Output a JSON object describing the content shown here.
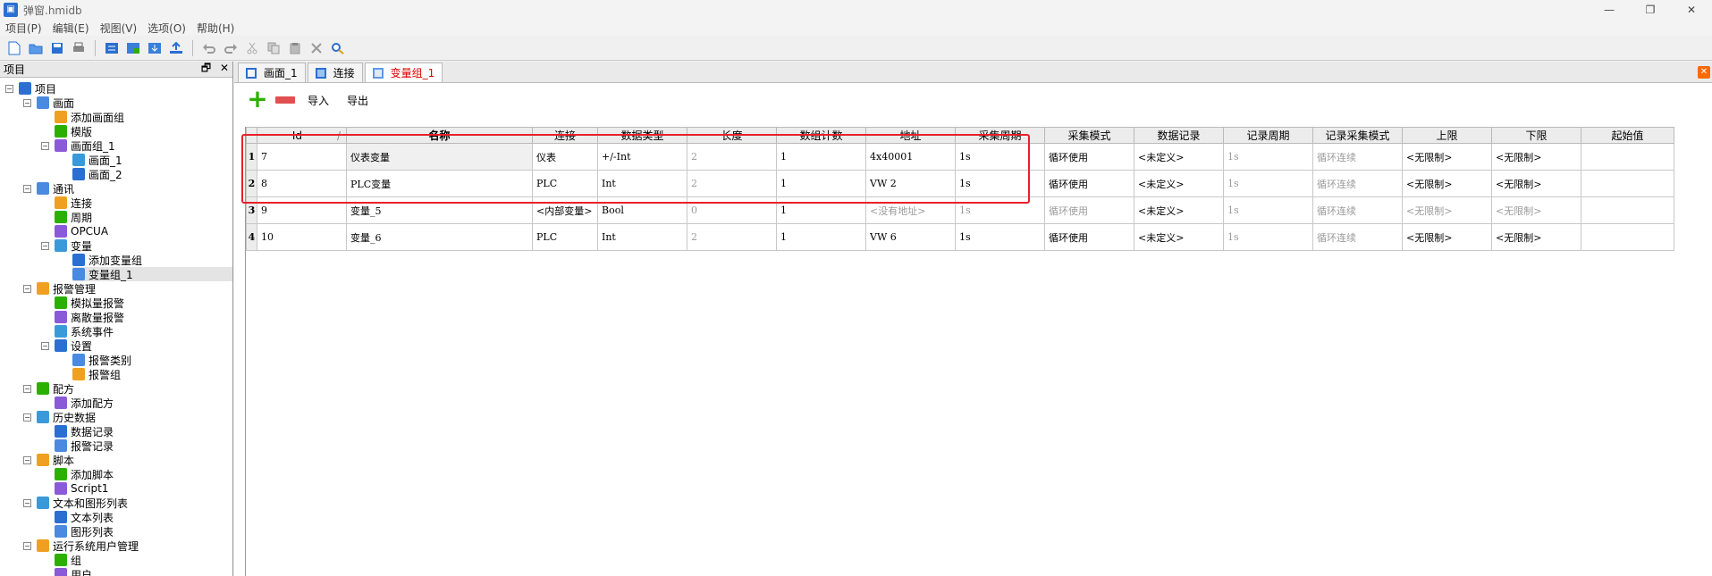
{
  "window": {
    "title": "弹窗.hmidb",
    "minimize": "—",
    "restore": "❐",
    "close": "✕"
  },
  "menu": [
    "项目(P)",
    "编辑(E)",
    "视图(V)",
    "选项(O)",
    "帮助(H)"
  ],
  "tree": {
    "header": "项目",
    "pin": "🗗",
    "close": "✕",
    "nodes": [
      {
        "label": "项目",
        "level": 0,
        "exp": "−",
        "icon": "project-icon"
      },
      {
        "label": "画面",
        "level": 1,
        "exp": "−",
        "icon": "screen-icon"
      },
      {
        "label": "添加画面组",
        "level": 2,
        "icon": "add-screen-group-icon"
      },
      {
        "label": "模版",
        "level": 2,
        "icon": "template-icon"
      },
      {
        "label": "画面组_1",
        "level": 2,
        "exp": "−",
        "icon": "screen-group-icon"
      },
      {
        "label": "画面_1",
        "level": 3,
        "icon": "screen-icon"
      },
      {
        "label": "画面_2",
        "level": 3,
        "icon": "screen-icon"
      },
      {
        "label": "通讯",
        "level": 1,
        "exp": "−",
        "icon": "comm-icon"
      },
      {
        "label": "连接",
        "level": 2,
        "icon": "connection-icon"
      },
      {
        "label": "周期",
        "level": 2,
        "icon": "cycle-icon"
      },
      {
        "label": "OPCUA",
        "level": 2,
        "icon": "opcua-icon"
      },
      {
        "label": "变量",
        "level": 2,
        "exp": "−",
        "icon": "variable-icon"
      },
      {
        "label": "添加变量组",
        "level": 3,
        "icon": "add-variable-group-icon"
      },
      {
        "label": "变量组_1",
        "level": 3,
        "icon": "variable-group-icon",
        "selected": true
      },
      {
        "label": "报警管理",
        "level": 1,
        "exp": "−",
        "icon": "alarm-icon"
      },
      {
        "label": "模拟量报警",
        "level": 2,
        "icon": "analog-alarm-icon"
      },
      {
        "label": "离散量报警",
        "level": 2,
        "icon": "discrete-alarm-icon"
      },
      {
        "label": "系统事件",
        "level": 2,
        "icon": "system-event-icon"
      },
      {
        "label": "设置",
        "level": 2,
        "exp": "−",
        "icon": "settings-icon"
      },
      {
        "label": "报警类别",
        "level": 3,
        "icon": "alarm-class-icon"
      },
      {
        "label": "报警组",
        "level": 3,
        "icon": "alarm-group-icon"
      },
      {
        "label": "配方",
        "level": 1,
        "exp": "−",
        "icon": "recipe-icon"
      },
      {
        "label": "添加配方",
        "level": 2,
        "icon": "add-recipe-icon"
      },
      {
        "label": "历史数据",
        "level": 1,
        "exp": "−",
        "icon": "history-icon"
      },
      {
        "label": "数据记录",
        "level": 2,
        "icon": "data-log-icon"
      },
      {
        "label": "报警记录",
        "level": 2,
        "icon": "alarm-log-icon"
      },
      {
        "label": "脚本",
        "level": 1,
        "exp": "−",
        "icon": "script-icon"
      },
      {
        "label": "添加脚本",
        "level": 2,
        "icon": "add-script-icon"
      },
      {
        "label": "Script1",
        "level": 2,
        "icon": "script-file-icon"
      },
      {
        "label": "文本和图形列表",
        "level": 1,
        "exp": "−",
        "icon": "text-graphic-list-icon"
      },
      {
        "label": "文本列表",
        "level": 2,
        "icon": "text-list-icon"
      },
      {
        "label": "图形列表",
        "level": 2,
        "icon": "graphic-list-icon"
      },
      {
        "label": "运行系统用户管理",
        "level": 1,
        "exp": "−",
        "icon": "user-management-icon"
      },
      {
        "label": "组",
        "level": 2,
        "icon": "group-icon"
      },
      {
        "label": "用户",
        "level": 2,
        "icon": "user-icon"
      }
    ]
  },
  "tabs": [
    {
      "label": "画面_1",
      "icon": "screen-icon"
    },
    {
      "label": "连接",
      "icon": "connection-icon"
    },
    {
      "label": "变量组_1",
      "icon": "variable-group-icon",
      "active": true
    }
  ],
  "actions": {
    "add": "+",
    "import": "导入",
    "export": "导出"
  },
  "grid": {
    "headers": [
      "Id",
      "名称",
      "连接",
      "数据类型",
      "长度",
      "数组计数",
      "地址",
      "采集周期",
      "采集模式",
      "数据记录",
      "记录周期",
      "记录采集模式",
      "上限",
      "下限",
      "起始值"
    ],
    "sort_indicator": "/",
    "rows": [
      {
        "n": "1",
        "cells": [
          "7",
          "仪表变量",
          "仪表",
          "+/-Int",
          "2",
          "1",
          "4x40001",
          "1s",
          "循环使用",
          "<未定义>",
          "1s",
          "循环连续",
          "<无限制>",
          "<无限制>",
          ""
        ]
      },
      {
        "n": "2",
        "cells": [
          "8",
          "PLC变量",
          "PLC",
          "Int",
          "2",
          "1",
          "VW 2",
          "1s",
          "循环使用",
          "<未定义>",
          "1s",
          "循环连续",
          "<无限制>",
          "<无限制>",
          ""
        ]
      },
      {
        "n": "3",
        "cells": [
          "9",
          "变量_5",
          "<内部变量>",
          "Bool",
          "0",
          "1",
          "<没有地址>",
          "1s",
          "循环使用",
          "<未定义>",
          "1s",
          "循环连续",
          "<无限制>",
          "<无限制>",
          ""
        ]
      },
      {
        "n": "4",
        "cells": [
          "10",
          "变量_6",
          "PLC",
          "Int",
          "2",
          "1",
          "VW 6",
          "1s",
          "循环使用",
          "<未定义>",
          "1s",
          "循环连续",
          "<无限制>",
          "<无限制>",
          ""
        ]
      }
    ]
  },
  "colors": {
    "highlight": "#e8202a",
    "active_tab_text": "#dd0000",
    "add": "#2cb000",
    "delete": "#e05050"
  }
}
